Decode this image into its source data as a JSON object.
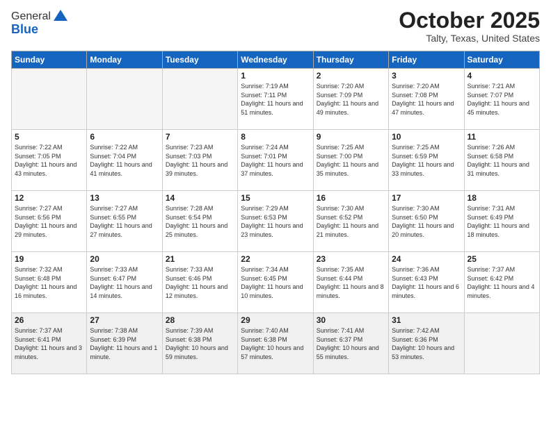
{
  "header": {
    "logo_general": "General",
    "logo_blue": "Blue",
    "month_title": "October 2025",
    "location": "Talty, Texas, United States"
  },
  "days_of_week": [
    "Sunday",
    "Monday",
    "Tuesday",
    "Wednesday",
    "Thursday",
    "Friday",
    "Saturday"
  ],
  "weeks": [
    [
      {
        "day": "",
        "sunrise": "",
        "sunset": "",
        "daylight": ""
      },
      {
        "day": "",
        "sunrise": "",
        "sunset": "",
        "daylight": ""
      },
      {
        "day": "",
        "sunrise": "",
        "sunset": "",
        "daylight": ""
      },
      {
        "day": "1",
        "sunrise": "Sunrise: 7:19 AM",
        "sunset": "Sunset: 7:11 PM",
        "daylight": "Daylight: 11 hours and 51 minutes."
      },
      {
        "day": "2",
        "sunrise": "Sunrise: 7:20 AM",
        "sunset": "Sunset: 7:09 PM",
        "daylight": "Daylight: 11 hours and 49 minutes."
      },
      {
        "day": "3",
        "sunrise": "Sunrise: 7:20 AM",
        "sunset": "Sunset: 7:08 PM",
        "daylight": "Daylight: 11 hours and 47 minutes."
      },
      {
        "day": "4",
        "sunrise": "Sunrise: 7:21 AM",
        "sunset": "Sunset: 7:07 PM",
        "daylight": "Daylight: 11 hours and 45 minutes."
      }
    ],
    [
      {
        "day": "5",
        "sunrise": "Sunrise: 7:22 AM",
        "sunset": "Sunset: 7:05 PM",
        "daylight": "Daylight: 11 hours and 43 minutes."
      },
      {
        "day": "6",
        "sunrise": "Sunrise: 7:22 AM",
        "sunset": "Sunset: 7:04 PM",
        "daylight": "Daylight: 11 hours and 41 minutes."
      },
      {
        "day": "7",
        "sunrise": "Sunrise: 7:23 AM",
        "sunset": "Sunset: 7:03 PM",
        "daylight": "Daylight: 11 hours and 39 minutes."
      },
      {
        "day": "8",
        "sunrise": "Sunrise: 7:24 AM",
        "sunset": "Sunset: 7:01 PM",
        "daylight": "Daylight: 11 hours and 37 minutes."
      },
      {
        "day": "9",
        "sunrise": "Sunrise: 7:25 AM",
        "sunset": "Sunset: 7:00 PM",
        "daylight": "Daylight: 11 hours and 35 minutes."
      },
      {
        "day": "10",
        "sunrise": "Sunrise: 7:25 AM",
        "sunset": "Sunset: 6:59 PM",
        "daylight": "Daylight: 11 hours and 33 minutes."
      },
      {
        "day": "11",
        "sunrise": "Sunrise: 7:26 AM",
        "sunset": "Sunset: 6:58 PM",
        "daylight": "Daylight: 11 hours and 31 minutes."
      }
    ],
    [
      {
        "day": "12",
        "sunrise": "Sunrise: 7:27 AM",
        "sunset": "Sunset: 6:56 PM",
        "daylight": "Daylight: 11 hours and 29 minutes."
      },
      {
        "day": "13",
        "sunrise": "Sunrise: 7:27 AM",
        "sunset": "Sunset: 6:55 PM",
        "daylight": "Daylight: 11 hours and 27 minutes."
      },
      {
        "day": "14",
        "sunrise": "Sunrise: 7:28 AM",
        "sunset": "Sunset: 6:54 PM",
        "daylight": "Daylight: 11 hours and 25 minutes."
      },
      {
        "day": "15",
        "sunrise": "Sunrise: 7:29 AM",
        "sunset": "Sunset: 6:53 PM",
        "daylight": "Daylight: 11 hours and 23 minutes."
      },
      {
        "day": "16",
        "sunrise": "Sunrise: 7:30 AM",
        "sunset": "Sunset: 6:52 PM",
        "daylight": "Daylight: 11 hours and 21 minutes."
      },
      {
        "day": "17",
        "sunrise": "Sunrise: 7:30 AM",
        "sunset": "Sunset: 6:50 PM",
        "daylight": "Daylight: 11 hours and 20 minutes."
      },
      {
        "day": "18",
        "sunrise": "Sunrise: 7:31 AM",
        "sunset": "Sunset: 6:49 PM",
        "daylight": "Daylight: 11 hours and 18 minutes."
      }
    ],
    [
      {
        "day": "19",
        "sunrise": "Sunrise: 7:32 AM",
        "sunset": "Sunset: 6:48 PM",
        "daylight": "Daylight: 11 hours and 16 minutes."
      },
      {
        "day": "20",
        "sunrise": "Sunrise: 7:33 AM",
        "sunset": "Sunset: 6:47 PM",
        "daylight": "Daylight: 11 hours and 14 minutes."
      },
      {
        "day": "21",
        "sunrise": "Sunrise: 7:33 AM",
        "sunset": "Sunset: 6:46 PM",
        "daylight": "Daylight: 11 hours and 12 minutes."
      },
      {
        "day": "22",
        "sunrise": "Sunrise: 7:34 AM",
        "sunset": "Sunset: 6:45 PM",
        "daylight": "Daylight: 11 hours and 10 minutes."
      },
      {
        "day": "23",
        "sunrise": "Sunrise: 7:35 AM",
        "sunset": "Sunset: 6:44 PM",
        "daylight": "Daylight: 11 hours and 8 minutes."
      },
      {
        "day": "24",
        "sunrise": "Sunrise: 7:36 AM",
        "sunset": "Sunset: 6:43 PM",
        "daylight": "Daylight: 11 hours and 6 minutes."
      },
      {
        "day": "25",
        "sunrise": "Sunrise: 7:37 AM",
        "sunset": "Sunset: 6:42 PM",
        "daylight": "Daylight: 11 hours and 4 minutes."
      }
    ],
    [
      {
        "day": "26",
        "sunrise": "Sunrise: 7:37 AM",
        "sunset": "Sunset: 6:41 PM",
        "daylight": "Daylight: 11 hours and 3 minutes."
      },
      {
        "day": "27",
        "sunrise": "Sunrise: 7:38 AM",
        "sunset": "Sunset: 6:39 PM",
        "daylight": "Daylight: 11 hours and 1 minute."
      },
      {
        "day": "28",
        "sunrise": "Sunrise: 7:39 AM",
        "sunset": "Sunset: 6:38 PM",
        "daylight": "Daylight: 10 hours and 59 minutes."
      },
      {
        "day": "29",
        "sunrise": "Sunrise: 7:40 AM",
        "sunset": "Sunset: 6:38 PM",
        "daylight": "Daylight: 10 hours and 57 minutes."
      },
      {
        "day": "30",
        "sunrise": "Sunrise: 7:41 AM",
        "sunset": "Sunset: 6:37 PM",
        "daylight": "Daylight: 10 hours and 55 minutes."
      },
      {
        "day": "31",
        "sunrise": "Sunrise: 7:42 AM",
        "sunset": "Sunset: 6:36 PM",
        "daylight": "Daylight: 10 hours and 53 minutes."
      },
      {
        "day": "",
        "sunrise": "",
        "sunset": "",
        "daylight": ""
      }
    ]
  ]
}
